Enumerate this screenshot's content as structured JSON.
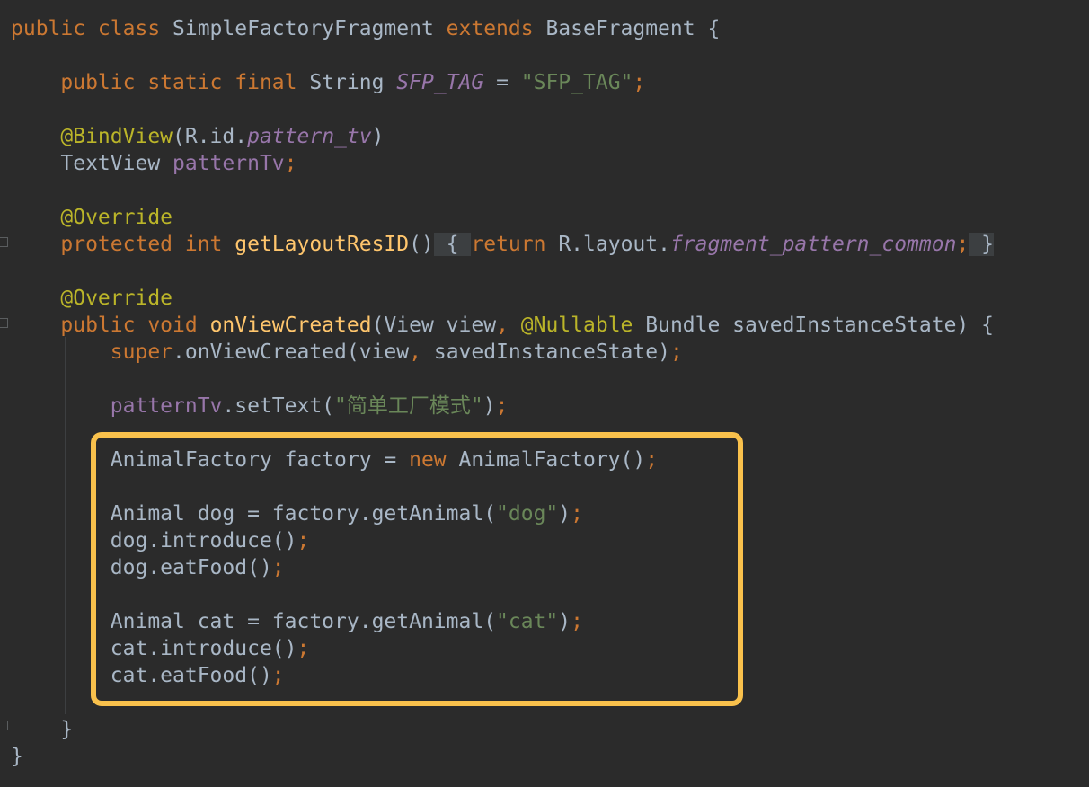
{
  "editor": {
    "lines": [
      [
        [
          "kw",
          "public class "
        ],
        [
          "plain",
          "SimpleFactoryFragment "
        ],
        [
          "kw",
          "extends "
        ],
        [
          "plain",
          "BaseFragment {"
        ]
      ],
      [],
      [
        [
          "plain",
          "    "
        ],
        [
          "kw",
          "public static final "
        ],
        [
          "plain",
          "String "
        ],
        [
          "field-i",
          "SFP_TAG"
        ],
        [
          "plain",
          " = "
        ],
        [
          "str",
          "\"SFP_TAG\""
        ],
        [
          "kw",
          ";"
        ]
      ],
      [],
      [
        [
          "plain",
          "    "
        ],
        [
          "anno",
          "@BindView"
        ],
        [
          "plain",
          "(R.id."
        ],
        [
          "field-i",
          "pattern_tv"
        ],
        [
          "plain",
          ")"
        ]
      ],
      [
        [
          "plain",
          "    TextView "
        ],
        [
          "field",
          "patternTv"
        ],
        [
          "kw",
          ";"
        ]
      ],
      [],
      [
        [
          "plain",
          "    "
        ],
        [
          "anno",
          "@Override"
        ]
      ],
      [
        [
          "plain",
          "    "
        ],
        [
          "kw",
          "protected int "
        ],
        [
          "meth",
          "getLayoutResID"
        ],
        [
          "plain",
          "()"
        ],
        [
          "fold-bg",
          " { "
        ],
        [
          "kw",
          "return "
        ],
        [
          "plain",
          "R.layout."
        ],
        [
          "field-i",
          "fragment_pattern_common"
        ],
        [
          "kw",
          ";"
        ],
        [
          "fold-bg",
          " }"
        ]
      ],
      [],
      [
        [
          "plain",
          "    "
        ],
        [
          "anno",
          "@Override"
        ]
      ],
      [
        [
          "plain",
          "    "
        ],
        [
          "kw",
          "public void "
        ],
        [
          "meth",
          "onViewCreated"
        ],
        [
          "plain",
          "(View view"
        ],
        [
          "kw",
          ", "
        ],
        [
          "anno",
          "@Nullable "
        ],
        [
          "plain",
          "Bundle savedInstanceState) {"
        ]
      ],
      [
        [
          "plain",
          "        "
        ],
        [
          "kw",
          "super"
        ],
        [
          "plain",
          ".onViewCreated(view"
        ],
        [
          "kw",
          ", "
        ],
        [
          "plain",
          "savedInstanceState)"
        ],
        [
          "kw",
          ";"
        ]
      ],
      [],
      [
        [
          "plain",
          "        "
        ],
        [
          "field",
          "patternTv"
        ],
        [
          "plain",
          ".setText("
        ],
        [
          "str",
          "\"简单工厂模式\""
        ],
        [
          "plain",
          ")"
        ],
        [
          "kw",
          ";"
        ]
      ],
      [],
      [
        [
          "plain",
          "        AnimalFactory factory = "
        ],
        [
          "kw",
          "new "
        ],
        [
          "plain",
          "AnimalFactory()"
        ],
        [
          "kw",
          ";"
        ]
      ],
      [],
      [
        [
          "plain",
          "        Animal dog = factory.getAnimal("
        ],
        [
          "str",
          "\"dog\""
        ],
        [
          "plain",
          ")"
        ],
        [
          "kw",
          ";"
        ]
      ],
      [
        [
          "plain",
          "        dog.introduce()"
        ],
        [
          "kw",
          ";"
        ]
      ],
      [
        [
          "plain",
          "        dog.eatFood()"
        ],
        [
          "kw",
          ";"
        ]
      ],
      [],
      [
        [
          "plain",
          "        Animal cat = factory.getAnimal("
        ],
        [
          "str",
          "\"cat\""
        ],
        [
          "plain",
          ")"
        ],
        [
          "kw",
          ";"
        ]
      ],
      [
        [
          "plain",
          "        cat.introduce()"
        ],
        [
          "kw",
          ";"
        ]
      ],
      [
        [
          "plain",
          "        cat.eatFood()"
        ],
        [
          "kw",
          ";"
        ]
      ],
      [],
      [
        [
          "plain",
          "    }"
        ]
      ],
      [
        [
          "plain",
          "}"
        ]
      ]
    ],
    "highlight_color": "#f9c14c"
  }
}
